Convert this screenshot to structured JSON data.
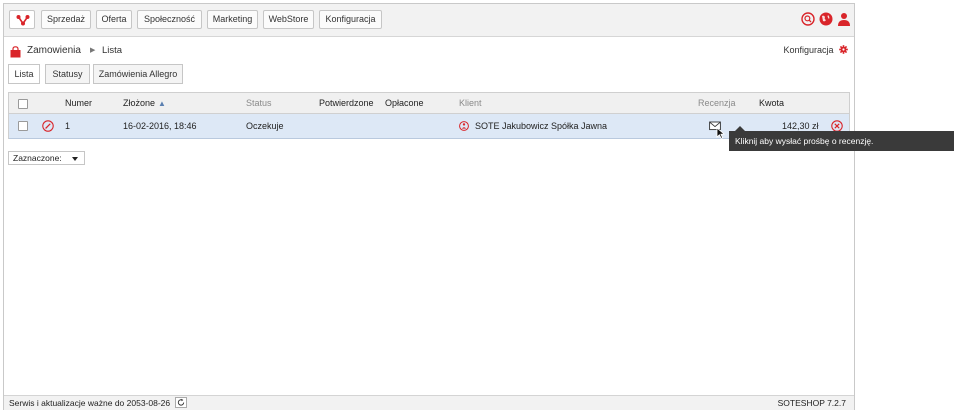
{
  "topbar": {
    "logo_icon": "soteshop-logo-icon",
    "menu": [
      "Sprzedaż",
      "Oferta",
      "Społeczność",
      "Marketing",
      "WebStore",
      "Konfiguracja"
    ],
    "icons": [
      "search-icon",
      "globe-icon",
      "user-icon"
    ]
  },
  "breadcrumb": {
    "section": "Zamowienia",
    "page": "Lista",
    "icon": "shopping-bag-icon"
  },
  "config_link": {
    "label": "Konfiguracja",
    "icon": "gear-icon"
  },
  "tabs": [
    {
      "label": "Lista",
      "active": true
    },
    {
      "label": "Statusy",
      "active": false
    },
    {
      "label": "Zamówienia Allegro",
      "active": false
    }
  ],
  "table": {
    "columns": {
      "numer": "Numer",
      "zlozone": "Złożone",
      "sort_indicator": "▲",
      "status": "Status",
      "potwierdzone": "Potwierdzone",
      "oplacone": "Opłacone",
      "klient": "Klient",
      "recenzja": "Recenzja",
      "kwota": "Kwota"
    },
    "rows": [
      {
        "numer": "1",
        "zlozone": "16-02-2016, 18:46",
        "status": "Oczekuje",
        "potwierdzone": "",
        "oplacone": "",
        "klient": "SOTE Jakubowicz Spółka Jawna",
        "kwota": "142,30 zł",
        "icons": [
          "edit-icon",
          "client-info-icon",
          "envelope-icon",
          "delete-icon"
        ]
      }
    ]
  },
  "tooltip": "Kliknij aby wysłać prośbę o recenzję.",
  "bulk_select": {
    "value": "Zaznaczone:"
  },
  "footer": {
    "service": "Serwis i aktualizacje ważne do 2053-08-26",
    "version": "SOTESHOP 7.2.7"
  },
  "colors": {
    "accent": "#d9252a",
    "row_highlight": "#dde8f6",
    "tooltip_bg": "#3a3a3a"
  }
}
